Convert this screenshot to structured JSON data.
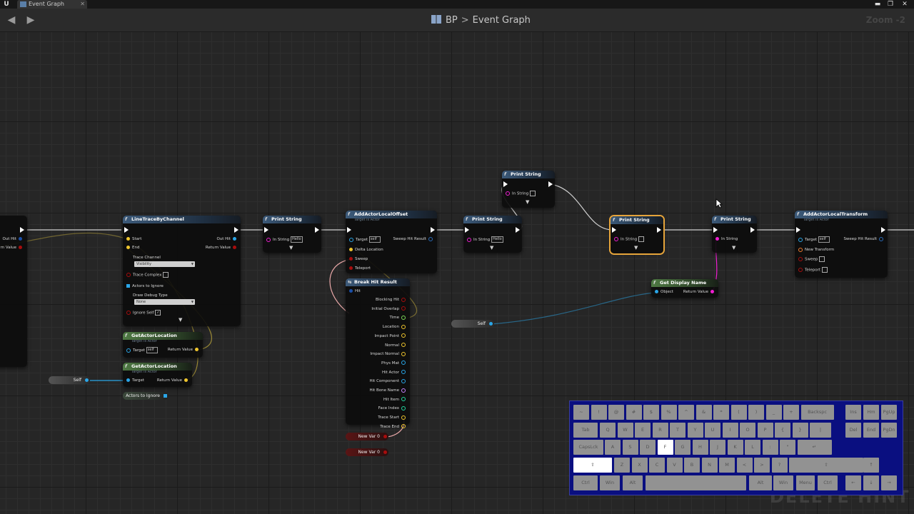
{
  "window": {
    "tab_label": "Event Graph",
    "tab_close": "✕",
    "controls": [
      "▬",
      "❐",
      "✕"
    ],
    "logo": "U"
  },
  "toolbar": {
    "back_icon": "back-arrow-icon",
    "forward_icon": "forward-arrow-icon",
    "breadcrumb_root": "BP",
    "breadcrumb_sep": ">",
    "breadcrumb_current": "Event Graph",
    "zoom": "Zoom -2"
  },
  "colors": {
    "exec": "#ffffff",
    "object_pin": "#2aa6e8",
    "vector_pin": "#f0c62e",
    "bool_pin": "#a80d0d",
    "string_pin": "#f01ed2",
    "struct_pin": "#1b4fa8",
    "name_pin": "#c882ff",
    "selection": "#e6a43a",
    "keyboard_bg": "#0a0f80"
  },
  "nodes": {
    "left_partial": {
      "out_hit": "Out Hit",
      "return_value": "rn Value"
    },
    "line_trace": {
      "title": "LineTraceByChannel",
      "start": "Start",
      "end": "End",
      "out_hit": "Out Hit",
      "return_value": "Return Value",
      "trace_channel": "Trace Channel",
      "trace_channel_value": "Visibility",
      "trace_complex": "Trace Complex",
      "actors_to_ignore": "Actors to Ignore",
      "draw_debug_type": "Draw Debug Type",
      "draw_debug_value": "None",
      "ignore_self": "Ignore Self"
    },
    "get_actor_location_1": {
      "title": "GetActorLocation",
      "subtitle": "Target is Actor",
      "target": "Target",
      "target_value": "self",
      "return_value": "Return Value"
    },
    "get_actor_location_2": {
      "title": "GetActorLocation",
      "subtitle": "Target is Actor",
      "target": "Target",
      "return_value": "Return Value"
    },
    "self_var_left": {
      "label": "Self"
    },
    "actors_to_ignore_var": {
      "label": "Actors to Ignore"
    },
    "print_string_1": {
      "title": "Print String",
      "in_string": "In String",
      "value": "Hello"
    },
    "add_actor_local_offset": {
      "title": "AddActorLocalOffset",
      "subtitle": "Target is Actor",
      "target": "Target",
      "target_value": "self",
      "sweep_hit_result": "Sweep Hit Result",
      "delta_location": "Delta Location",
      "sweep": "Sweep",
      "teleport": "Teleport"
    },
    "break_hit_result": {
      "title": "Break Hit Result",
      "hit": "Hit",
      "outputs": [
        "Blocking Hit",
        "Initial Overlap",
        "Time",
        "Location",
        "Impact Point",
        "Normal",
        "Impact Normal",
        "Phys Mat",
        "Hit Actor",
        "Hit Component",
        "Hit Bone Name",
        "Hit Item",
        "Face Index",
        "Trace Start",
        "Trace End"
      ]
    },
    "new_var_0a": {
      "label": "New Var 0"
    },
    "new_var_0b": {
      "label": "New Var 0"
    },
    "print_string_2": {
      "title": "Print String",
      "in_string": "In String",
      "value": "Hello"
    },
    "print_string_top": {
      "title": "Print String",
      "in_string": "In String"
    },
    "self_var_mid": {
      "label": "Self"
    },
    "print_string_selected": {
      "title": "Print String",
      "in_string": "In String"
    },
    "get_display_name": {
      "title": "Get Display Name",
      "object": "Object",
      "return_value": "Return Value"
    },
    "print_string_4": {
      "title": "Print String",
      "in_string": "In String"
    },
    "add_actor_local_transform": {
      "title": "AddActorLocalTransform",
      "subtitle": "Target is Actor",
      "target": "Target",
      "target_value": "self",
      "sweep_hit_result": "Sweep Hit Result",
      "new_transform": "New Transform",
      "sweep": "Sweep",
      "teleport": "Teleport"
    }
  },
  "keyboard": {
    "row1": [
      "~",
      "!",
      "@",
      "#",
      "$",
      "%",
      "^",
      "&",
      "*",
      "(",
      ")",
      "_",
      "+",
      "Backspc"
    ],
    "row2": [
      "Tab",
      "Q",
      "W",
      "E",
      "R",
      "T",
      "Y",
      "U",
      "I",
      "O",
      "P",
      "{",
      "}",
      "|"
    ],
    "row3": [
      "CapsLck",
      "A",
      "S",
      "D",
      "F",
      "G",
      "H",
      "J",
      "K",
      "L",
      ":",
      "\"",
      "↵"
    ],
    "row4": [
      "⇧",
      "Z",
      "X",
      "C",
      "V",
      "B",
      "N",
      "M",
      "<",
      ">",
      "?",
      "⇧"
    ],
    "row5": [
      "Ctrl",
      "Win",
      "Alt",
      "Alt",
      "Win",
      "Menu",
      "Ctrl"
    ],
    "nav1": [
      "Ins",
      "Hm",
      "PgUp"
    ],
    "nav2": [
      "Del",
      "End",
      "PgDn"
    ],
    "arrows": [
      "↑",
      "←",
      "↓",
      "→"
    ],
    "pressed": [
      "F",
      "⇧ (left shift)"
    ]
  },
  "watermark": "DELETE HINT"
}
